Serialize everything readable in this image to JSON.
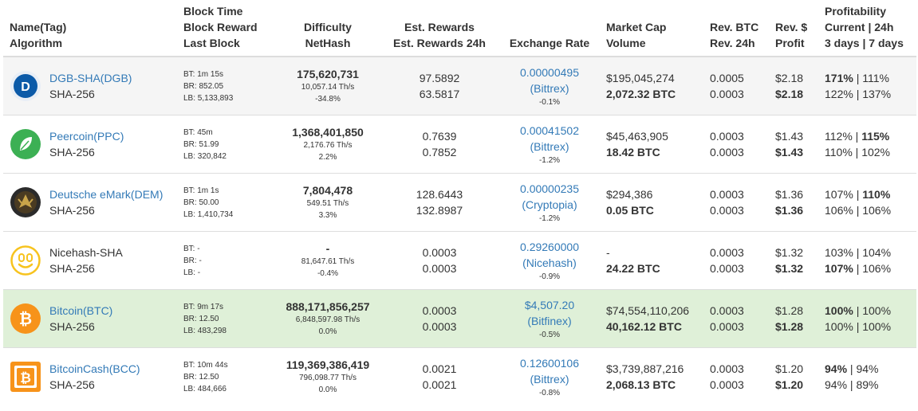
{
  "headers": {
    "name": [
      "Name(Tag)",
      "Algorithm"
    ],
    "block": [
      "Block Time",
      "Block Reward",
      "Last Block"
    ],
    "difficulty": [
      "Difficulty",
      "NetHash"
    ],
    "rewards": [
      "Est. Rewards",
      "Est. Rewards 24h"
    ],
    "exchange": [
      "Exchange Rate"
    ],
    "market": [
      "Market Cap",
      "Volume"
    ],
    "rev_btc": [
      "Rev. BTC",
      "Rev. 24h"
    ],
    "rev_usd": [
      "Rev. $",
      "Profit"
    ],
    "profit": [
      "Profitability",
      "Current | 24h",
      "3 days | 7 days"
    ]
  },
  "icons": {
    "dgb": "digibyte-icon",
    "ppc": "peercoin-icon",
    "dem": "deutsche-emark-icon",
    "nicehash": "nicehash-icon",
    "btc": "bitcoin-icon",
    "bcc": "bitcoincash-icon"
  },
  "colors": {
    "link": "#337ab7",
    "highlight_row": "#dff0d8",
    "stripe_row": "#f5f5f5"
  },
  "rows": [
    {
      "name": "DGB-SHA(DGB)",
      "algo": "SHA-256",
      "bt": "BT: 1m 15s",
      "br": "BR: 852.05",
      "lb": "LB: 5,133,893",
      "difficulty": "175,620,731",
      "nethash": "10,057.14 Th/s",
      "diff_change": "-34.8%",
      "est": "97.5892",
      "est24": "63.5817",
      "rate": "0.00000495",
      "exchange": "(Bittrex)",
      "rate_change": "-0.1%",
      "mcap": "$195,045,274",
      "volume": "2,072.32 BTC",
      "rev_btc": "0.0005",
      "rev_24h": "0.0003",
      "rev_usd": "$2.18",
      "profit_usd": "$2.18",
      "prof_cur": "171%",
      "prof_24h": "111%",
      "prof_3d": "122%",
      "prof_7d": "137%"
    },
    {
      "name": "Peercoin(PPC)",
      "algo": "SHA-256",
      "bt": "BT: 45m",
      "br": "BR: 51.99",
      "lb": "LB: 320,842",
      "difficulty": "1,368,401,850",
      "nethash": "2,176.76 Th/s",
      "diff_change": "2.2%",
      "est": "0.7639",
      "est24": "0.7852",
      "rate": "0.00041502",
      "exchange": "(Bittrex)",
      "rate_change": "-1.2%",
      "mcap": "$45,463,905",
      "volume": "18.42 BTC",
      "rev_btc": "0.0003",
      "rev_24h": "0.0003",
      "rev_usd": "$1.43",
      "profit_usd": "$1.43",
      "prof_cur": "112%",
      "prof_24h": "115%",
      "prof_3d": "110%",
      "prof_7d": "102%"
    },
    {
      "name": "Deutsche eMark(DEM)",
      "algo": "SHA-256",
      "bt": "BT: 1m 1s",
      "br": "BR: 50.00",
      "lb": "LB: 1,410,734",
      "difficulty": "7,804,478",
      "nethash": "549.51 Th/s",
      "diff_change": "3.3%",
      "est": "128.6443",
      "est24": "132.8987",
      "rate": "0.00000235",
      "exchange": "(Cryptopia)",
      "rate_change": "-1.2%",
      "mcap": "$294,386",
      "volume": "0.05 BTC",
      "rev_btc": "0.0003",
      "rev_24h": "0.0003",
      "rev_usd": "$1.36",
      "profit_usd": "$1.36",
      "prof_cur": "107%",
      "prof_24h": "110%",
      "prof_3d": "106%",
      "prof_7d": "106%"
    },
    {
      "name": "Nicehash-SHA",
      "algo": "SHA-256",
      "bt": "BT: -",
      "br": "BR: -",
      "lb": "LB: -",
      "difficulty": "-",
      "nethash": "81,647.61 Th/s",
      "diff_change": "-0.4%",
      "est": "0.0003",
      "est24": "0.0003",
      "rate": "0.29260000",
      "exchange": "(Nicehash)",
      "rate_change": "-0.9%",
      "mcap": "-",
      "volume": "24.22 BTC",
      "rev_btc": "0.0003",
      "rev_24h": "0.0003",
      "rev_usd": "$1.32",
      "profit_usd": "$1.32",
      "prof_cur": "103%",
      "prof_24h": "104%",
      "prof_3d": "107%",
      "prof_7d": "106%"
    },
    {
      "name": "Bitcoin(BTC)",
      "algo": "SHA-256",
      "bt": "BT: 9m 17s",
      "br": "BR: 12.50",
      "lb": "LB: 483,298",
      "difficulty": "888,171,856,257",
      "nethash": "6,848,597.98 Th/s",
      "diff_change": "0.0%",
      "est": "0.0003",
      "est24": "0.0003",
      "rate": "$4,507.20",
      "exchange": "(Bitfinex)",
      "rate_change": "-0.5%",
      "mcap": "$74,554,110,206",
      "volume": "40,162.12 BTC",
      "rev_btc": "0.0003",
      "rev_24h": "0.0003",
      "rev_usd": "$1.28",
      "profit_usd": "$1.28",
      "prof_cur": "100%",
      "prof_24h": "100%",
      "prof_3d": "100%",
      "prof_7d": "100%"
    },
    {
      "name": "BitcoinCash(BCC)",
      "algo": "SHA-256",
      "bt": "BT: 10m 44s",
      "br": "BR: 12.50",
      "lb": "LB: 484,666",
      "difficulty": "119,369,386,419",
      "nethash": "796,098.77 Th/s",
      "diff_change": "0.0%",
      "est": "0.0021",
      "est24": "0.0021",
      "rate": "0.12600106",
      "exchange": "(Bittrex)",
      "rate_change": "-0.8%",
      "mcap": "$3,739,887,216",
      "volume": "2,068.13 BTC",
      "rev_btc": "0.0003",
      "rev_24h": "0.0003",
      "rev_usd": "$1.20",
      "profit_usd": "$1.20",
      "prof_cur": "94%",
      "prof_24h": "94%",
      "prof_3d": "94%",
      "prof_7d": "89%"
    }
  ]
}
